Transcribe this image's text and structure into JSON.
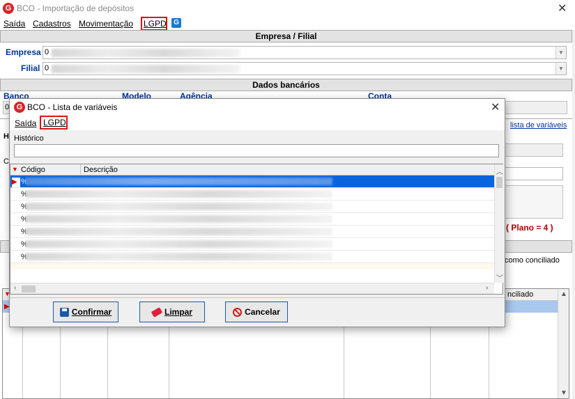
{
  "window": {
    "title": "BCO - Importação de depósitos"
  },
  "menu": {
    "items": [
      "Saída",
      "Cadastros",
      "Movimentação",
      "LGPD"
    ]
  },
  "empresa_filial": {
    "header": "Empresa / Filial",
    "empresa_label": "Empresa",
    "empresa_value": "0",
    "filial_label": "Filial",
    "filial_value": "0"
  },
  "dados_bancarios": {
    "header": "Dados bancários",
    "col_banco": "Banco",
    "col_modelo": "Modelo",
    "col_agencia": "Agência",
    "col_conta": "Conta",
    "banco_value": "0"
  },
  "background_misc": {
    "lista_link": "lista de variáveis",
    "plano_text": "( Plano = 4 )",
    "conciliado_text": "como conciliado",
    "conciliado_col": "nciliado",
    "h_label": "H",
    "c_label": "C"
  },
  "dialog": {
    "title": "BCO - Lista de variáveis",
    "menu": [
      "Saída",
      "LGPD"
    ],
    "historico_label": "Histórico",
    "historico_value": "",
    "columns": [
      "Código",
      "Descrição"
    ],
    "rows": [
      {
        "code": "%",
        "desc": "",
        "selected": true
      },
      {
        "code": "%",
        "desc": "",
        "selected": false
      },
      {
        "code": "%",
        "desc": "",
        "selected": false
      },
      {
        "code": "%",
        "desc": "",
        "selected": false
      },
      {
        "code": "%",
        "desc": "",
        "selected": false
      },
      {
        "code": "%",
        "desc": "",
        "selected": false
      },
      {
        "code": "%",
        "desc": "",
        "selected": false
      }
    ],
    "buttons": {
      "confirmar": "Confirmar",
      "limpar": "Limpar",
      "cancelar": "Cancelar"
    }
  },
  "colors": {
    "accent_blue": "#003399",
    "selection": "#0a64dc",
    "highlight_red": "#e01010",
    "plano_red": "#b00000"
  }
}
